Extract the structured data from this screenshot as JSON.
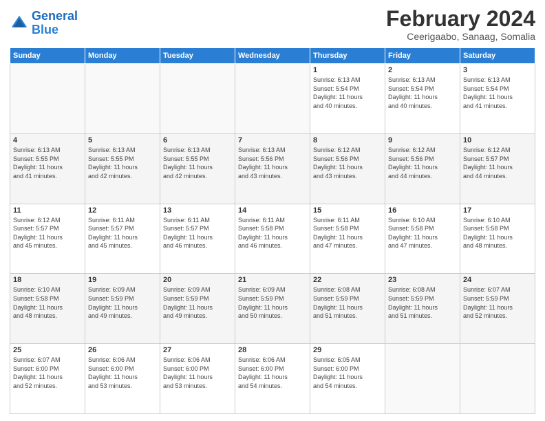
{
  "logo": {
    "line1": "General",
    "line2": "Blue"
  },
  "title": "February 2024",
  "subtitle": "Ceerigaabo, Sanaag, Somalia",
  "headers": [
    "Sunday",
    "Monday",
    "Tuesday",
    "Wednesday",
    "Thursday",
    "Friday",
    "Saturday"
  ],
  "weeks": [
    [
      {
        "day": "",
        "info": ""
      },
      {
        "day": "",
        "info": ""
      },
      {
        "day": "",
        "info": ""
      },
      {
        "day": "",
        "info": ""
      },
      {
        "day": "1",
        "info": "Sunrise: 6:13 AM\nSunset: 5:54 PM\nDaylight: 11 hours\nand 40 minutes."
      },
      {
        "day": "2",
        "info": "Sunrise: 6:13 AM\nSunset: 5:54 PM\nDaylight: 11 hours\nand 40 minutes."
      },
      {
        "day": "3",
        "info": "Sunrise: 6:13 AM\nSunset: 5:54 PM\nDaylight: 11 hours\nand 41 minutes."
      }
    ],
    [
      {
        "day": "4",
        "info": "Sunrise: 6:13 AM\nSunset: 5:55 PM\nDaylight: 11 hours\nand 41 minutes."
      },
      {
        "day": "5",
        "info": "Sunrise: 6:13 AM\nSunset: 5:55 PM\nDaylight: 11 hours\nand 42 minutes."
      },
      {
        "day": "6",
        "info": "Sunrise: 6:13 AM\nSunset: 5:55 PM\nDaylight: 11 hours\nand 42 minutes."
      },
      {
        "day": "7",
        "info": "Sunrise: 6:13 AM\nSunset: 5:56 PM\nDaylight: 11 hours\nand 43 minutes."
      },
      {
        "day": "8",
        "info": "Sunrise: 6:12 AM\nSunset: 5:56 PM\nDaylight: 11 hours\nand 43 minutes."
      },
      {
        "day": "9",
        "info": "Sunrise: 6:12 AM\nSunset: 5:56 PM\nDaylight: 11 hours\nand 44 minutes."
      },
      {
        "day": "10",
        "info": "Sunrise: 6:12 AM\nSunset: 5:57 PM\nDaylight: 11 hours\nand 44 minutes."
      }
    ],
    [
      {
        "day": "11",
        "info": "Sunrise: 6:12 AM\nSunset: 5:57 PM\nDaylight: 11 hours\nand 45 minutes."
      },
      {
        "day": "12",
        "info": "Sunrise: 6:11 AM\nSunset: 5:57 PM\nDaylight: 11 hours\nand 45 minutes."
      },
      {
        "day": "13",
        "info": "Sunrise: 6:11 AM\nSunset: 5:57 PM\nDaylight: 11 hours\nand 46 minutes."
      },
      {
        "day": "14",
        "info": "Sunrise: 6:11 AM\nSunset: 5:58 PM\nDaylight: 11 hours\nand 46 minutes."
      },
      {
        "day": "15",
        "info": "Sunrise: 6:11 AM\nSunset: 5:58 PM\nDaylight: 11 hours\nand 47 minutes."
      },
      {
        "day": "16",
        "info": "Sunrise: 6:10 AM\nSunset: 5:58 PM\nDaylight: 11 hours\nand 47 minutes."
      },
      {
        "day": "17",
        "info": "Sunrise: 6:10 AM\nSunset: 5:58 PM\nDaylight: 11 hours\nand 48 minutes."
      }
    ],
    [
      {
        "day": "18",
        "info": "Sunrise: 6:10 AM\nSunset: 5:58 PM\nDaylight: 11 hours\nand 48 minutes."
      },
      {
        "day": "19",
        "info": "Sunrise: 6:09 AM\nSunset: 5:59 PM\nDaylight: 11 hours\nand 49 minutes."
      },
      {
        "day": "20",
        "info": "Sunrise: 6:09 AM\nSunset: 5:59 PM\nDaylight: 11 hours\nand 49 minutes."
      },
      {
        "day": "21",
        "info": "Sunrise: 6:09 AM\nSunset: 5:59 PM\nDaylight: 11 hours\nand 50 minutes."
      },
      {
        "day": "22",
        "info": "Sunrise: 6:08 AM\nSunset: 5:59 PM\nDaylight: 11 hours\nand 51 minutes."
      },
      {
        "day": "23",
        "info": "Sunrise: 6:08 AM\nSunset: 5:59 PM\nDaylight: 11 hours\nand 51 minutes."
      },
      {
        "day": "24",
        "info": "Sunrise: 6:07 AM\nSunset: 5:59 PM\nDaylight: 11 hours\nand 52 minutes."
      }
    ],
    [
      {
        "day": "25",
        "info": "Sunrise: 6:07 AM\nSunset: 6:00 PM\nDaylight: 11 hours\nand 52 minutes."
      },
      {
        "day": "26",
        "info": "Sunrise: 6:06 AM\nSunset: 6:00 PM\nDaylight: 11 hours\nand 53 minutes."
      },
      {
        "day": "27",
        "info": "Sunrise: 6:06 AM\nSunset: 6:00 PM\nDaylight: 11 hours\nand 53 minutes."
      },
      {
        "day": "28",
        "info": "Sunrise: 6:06 AM\nSunset: 6:00 PM\nDaylight: 11 hours\nand 54 minutes."
      },
      {
        "day": "29",
        "info": "Sunrise: 6:05 AM\nSunset: 6:00 PM\nDaylight: 11 hours\nand 54 minutes."
      },
      {
        "day": "",
        "info": ""
      },
      {
        "day": "",
        "info": ""
      }
    ]
  ]
}
